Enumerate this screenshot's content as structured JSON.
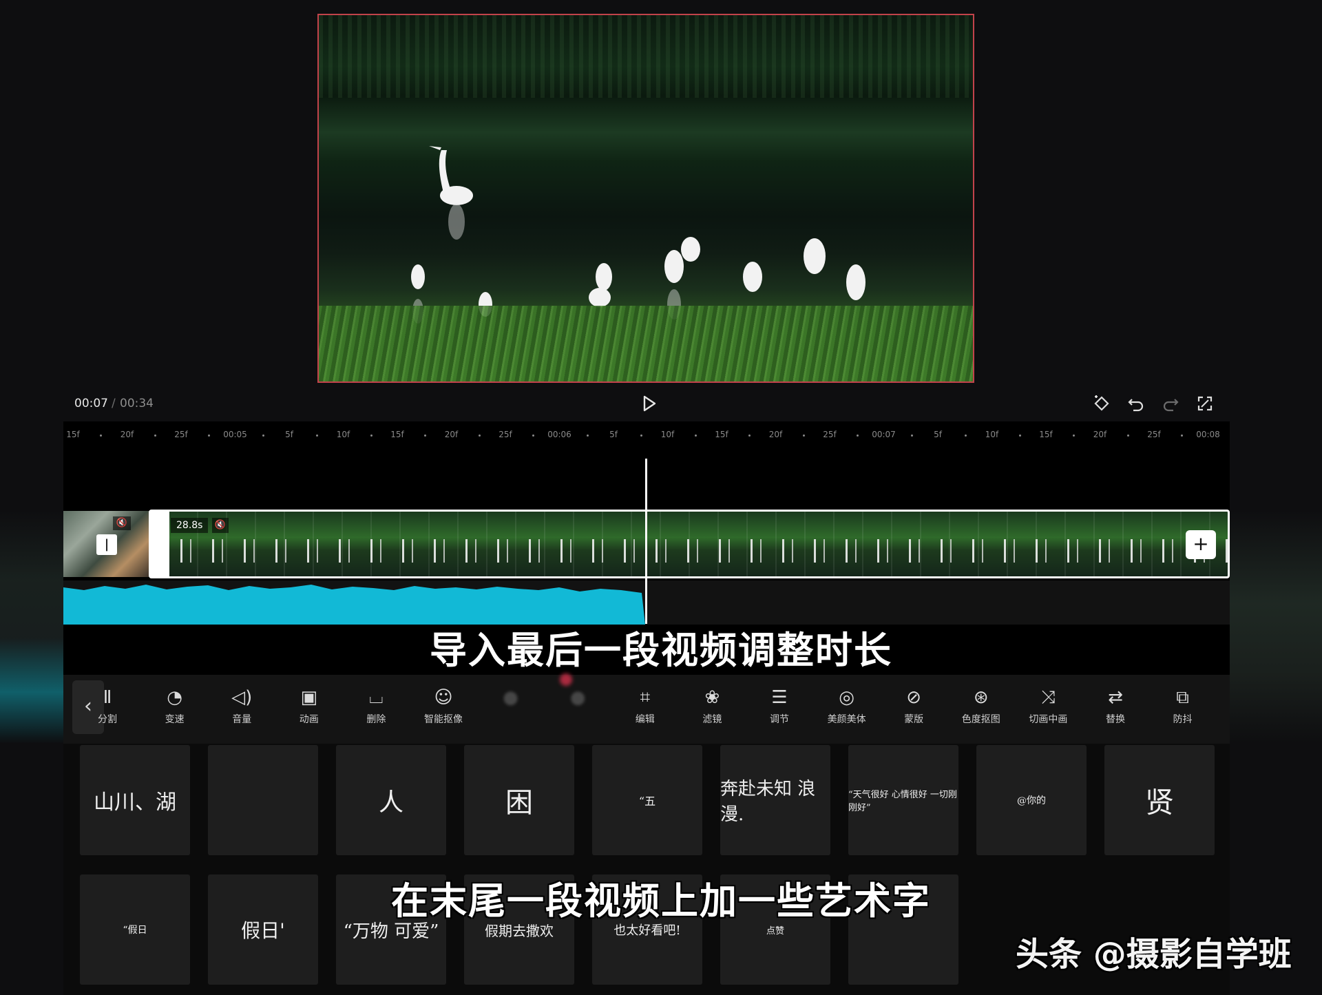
{
  "preview": {
    "border_color": "#c2434b"
  },
  "playback": {
    "current": "00:07",
    "separator": "/",
    "total": "00:34"
  },
  "ruler_ticks": [
    "15f",
    "20f",
    "25f",
    "00:05",
    "5f",
    "10f",
    "15f",
    "20f",
    "25f",
    "00:06",
    "5f",
    "10f",
    "15f",
    "20f",
    "25f",
    "00:07",
    "5f",
    "10f",
    "15f",
    "20f",
    "25f",
    "00:08"
  ],
  "clip": {
    "duration": "28.8s"
  },
  "audio": {
    "color": "#12b9d6",
    "played_fraction": 0.5
  },
  "subtitles": {
    "line1": "导入最后一段视频调整时长",
    "line2": "在末尾一段视频上加一些艺术字"
  },
  "toolbar": {
    "items": [
      {
        "label": "分割",
        "icon": "split-icon"
      },
      {
        "label": "变速",
        "icon": "speed-icon"
      },
      {
        "label": "音量",
        "icon": "volume-icon"
      },
      {
        "label": "动画",
        "icon": "animation-icon"
      },
      {
        "label": "删除",
        "icon": "delete-icon"
      },
      {
        "label": "智能抠像",
        "icon": "smart-cutout-icon"
      },
      {
        "label": "",
        "icon": "blurred-icon"
      },
      {
        "label": "",
        "icon": "blurred-icon"
      },
      {
        "label": "编辑",
        "icon": "crop-icon"
      },
      {
        "label": "滤镜",
        "icon": "filter-icon"
      },
      {
        "label": "调节",
        "icon": "adjust-icon"
      },
      {
        "label": "美颜美体",
        "icon": "beauty-icon"
      },
      {
        "label": "蒙版",
        "icon": "mask-icon"
      },
      {
        "label": "色度抠图",
        "icon": "chroma-key-icon"
      },
      {
        "label": "切画中画",
        "icon": "pip-icon"
      },
      {
        "label": "替换",
        "icon": "replace-icon"
      },
      {
        "label": "防抖",
        "icon": "stabilize-icon"
      }
    ]
  },
  "text_styles": {
    "row1": [
      "山川、湖",
      "",
      "人",
      "困",
      "“五",
      "奔赴未知 浪漫.",
      "“天气很好 心情很好 一切刚刚好”",
      "@你的",
      "贤"
    ],
    "row2": [
      "“假日",
      "假日'",
      "“万物 可爱”",
      "假期去撒欢",
      "也太好看吧!",
      "点赞",
      ""
    ]
  },
  "watermark": {
    "brand": "头条",
    "handle": "@摄影自学班"
  }
}
